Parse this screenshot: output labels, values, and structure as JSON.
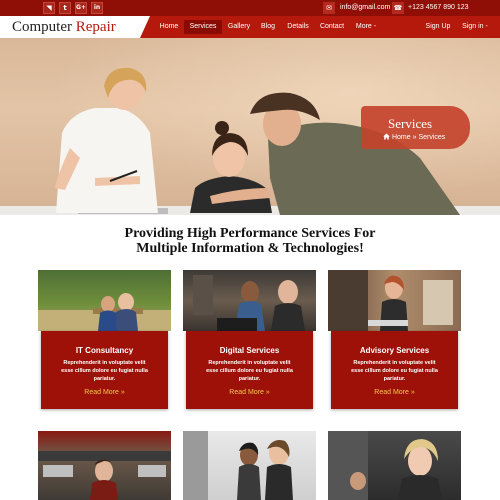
{
  "topbar": {
    "social": [
      {
        "name": "rss-icon",
        "glyph": "◥"
      },
      {
        "name": "twitter-icon",
        "glyph": "t"
      },
      {
        "name": "google-plus-icon",
        "glyph": "G+"
      },
      {
        "name": "linkedin-icon",
        "glyph": "in"
      }
    ],
    "email_glyph": "✉",
    "email": "info@gmail.com",
    "phone_glyph": "☎",
    "phone": "+123 4567 890 123"
  },
  "header": {
    "logo_word1": "Computer",
    "logo_word2": "Repair",
    "nav": [
      "Home",
      "Services",
      "Gallery",
      "Blog",
      "Details",
      "Contact",
      "More -"
    ],
    "active_nav": "Services",
    "signup": "Sign Up",
    "signin": "Sign in -"
  },
  "hero": {
    "title": "Services",
    "crumb_icon": "home-icon",
    "crumb_home": "Home",
    "crumb_sep": "»",
    "crumb_current": "Services"
  },
  "section": {
    "heading_line1": "Providing High Performance Services For",
    "heading_line2": "Multiple Information & Technologies!"
  },
  "services": [
    {
      "title": "IT Consultancy",
      "text": [
        "Reprehenderit in voluptate velit",
        "esse cillum dolore eu fugiat nulla",
        "pariatur."
      ],
      "link": "Read More »"
    },
    {
      "title": "Digital Services",
      "text": [
        "Reprehenderit in voluptate velit",
        "esse cillum dolore eu fugiat nulla",
        "pariatur."
      ],
      "link": "Read More »"
    },
    {
      "title": "Advisory Services",
      "text": [
        "Reprehenderit in voluptate velit",
        "esse cillum dolore eu fugiat nulla",
        "pariatur."
      ],
      "link": "Read More »"
    }
  ],
  "colors": {
    "topbar": "#8f0f06",
    "navbar": "#b5190c",
    "card": "#9e1109",
    "link": "#f2c94c",
    "banner": "#c4432c"
  }
}
